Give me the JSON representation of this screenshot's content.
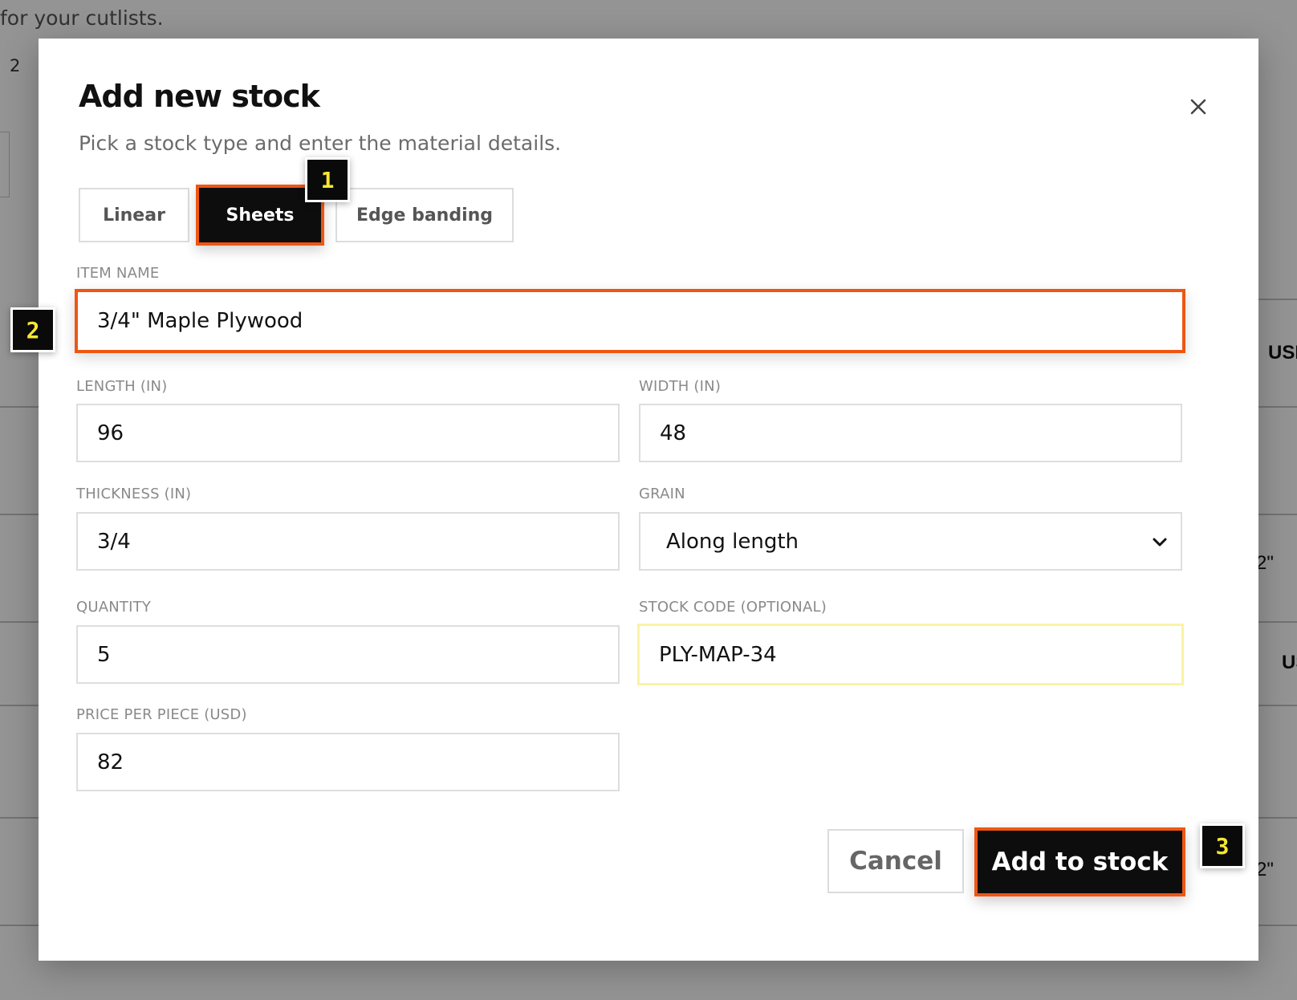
{
  "background": {
    "subtitle": "for your cutlists.",
    "count": "2",
    "right_fragments": [
      "USD",
      "2\"",
      "US",
      "2\""
    ]
  },
  "modal": {
    "title": "Add new stock",
    "subtitle": "Pick a stock type and enter the material details.",
    "close_icon": "close-icon",
    "tabs": [
      {
        "label": "Linear",
        "active": false
      },
      {
        "label": "Sheets",
        "active": true
      },
      {
        "label": "Edge banding",
        "active": false
      }
    ],
    "fields": {
      "item_name": {
        "label": "ITEM NAME",
        "value": "3/4\" Maple Plywood"
      },
      "length": {
        "label": "LENGTH (IN)",
        "value": "96"
      },
      "width": {
        "label": "WIDTH (IN)",
        "value": "48"
      },
      "thickness": {
        "label": "THICKNESS (IN)",
        "value": "3/4"
      },
      "grain": {
        "label": "GRAIN",
        "value": "Along length"
      },
      "quantity": {
        "label": "QUANTITY",
        "value": "5"
      },
      "stock_code": {
        "label": "STOCK CODE (OPTIONAL)",
        "value": "PLY-MAP-34"
      },
      "price": {
        "label": "PRICE PER PIECE (USD)",
        "value": "82"
      }
    },
    "buttons": {
      "cancel": "Cancel",
      "add": "Add to stock"
    }
  },
  "step_markers": [
    "1",
    "2",
    "3"
  ],
  "colors": {
    "accent_outline": "#ee5614",
    "marker_text": "#f5e733",
    "dark": "#0d0d0d"
  }
}
